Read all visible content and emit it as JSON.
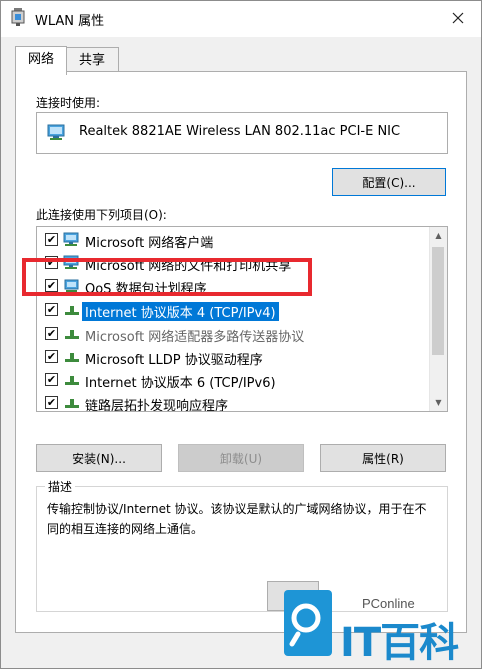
{
  "window": {
    "title": "WLAN 属性"
  },
  "tabs": [
    {
      "label": "网络",
      "active": true
    },
    {
      "label": "共享",
      "active": false
    }
  ],
  "connect_using": {
    "label": "连接时使用:",
    "adapter": "Realtek 8821AE Wireless LAN 802.11ac PCI-E NIC",
    "configure_button": "配置(C)..."
  },
  "items_section": {
    "label": "此连接使用下列项目(O):",
    "items": [
      {
        "label": "Microsoft 网络客户端",
        "checked": true,
        "icon": "network-client-icon"
      },
      {
        "label": "Microsoft 网络的文件和打印机共享",
        "checked": true,
        "icon": "file-printer-share-icon"
      },
      {
        "label": "QoS 数据包计划程序",
        "checked": true,
        "icon": "qos-icon"
      },
      {
        "label": "Internet 协议版本 4 (TCP/IPv4)",
        "checked": true,
        "icon": "protocol-icon",
        "selected": true
      },
      {
        "label": "Microsoft 网络适配器多路传送器协议",
        "checked": false,
        "icon": "protocol-icon"
      },
      {
        "label": "Microsoft LLDP 协议驱动程序",
        "checked": true,
        "icon": "protocol-icon"
      },
      {
        "label": "Internet 协议版本 6 (TCP/IPv6)",
        "checked": true,
        "icon": "protocol-icon"
      },
      {
        "label": "链路层拓扑发现响应程序",
        "checked": true,
        "icon": "protocol-icon"
      }
    ]
  },
  "buttons": {
    "install": "安装(N)...",
    "uninstall": "卸载(U)",
    "properties": "属性(R)"
  },
  "description": {
    "title": "描述",
    "text": "传输控制协议/Internet 协议。该协议是默认的广域网络协议，用于在不同的相互连接的网络上通信。"
  },
  "watermark": {
    "brand": "PConline",
    "logo_text": "IT百科"
  },
  "colors": {
    "selection": "#0078d7",
    "highlight_box": "#e8292f",
    "watermark_blue": "#1e95d6"
  }
}
